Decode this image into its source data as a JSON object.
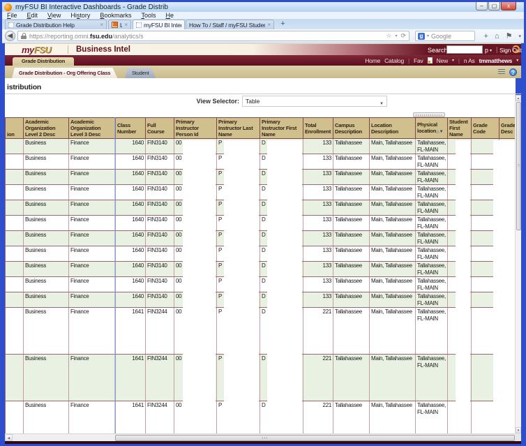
{
  "browser": {
    "title": "myFSU BI Interactive Dashboards - Grade Distrib",
    "menu": [
      {
        "pre": "",
        "key": "F",
        "rest": "ile"
      },
      {
        "pre": "",
        "key": "E",
        "rest": "dit"
      },
      {
        "pre": "",
        "key": "V",
        "rest": "iew"
      },
      {
        "pre": "Hi",
        "key": "s",
        "rest": "tory"
      },
      {
        "pre": "",
        "key": "B",
        "rest": "ookmarks"
      },
      {
        "pre": "",
        "key": "T",
        "rest": "ools"
      },
      {
        "pre": "",
        "key": "H",
        "rest": "e"
      }
    ],
    "tabs": [
      {
        "label": "Grade Distribution Help",
        "favicon": "blank",
        "active": false,
        "closable": true
      },
      {
        "label": "L",
        "favicon": "orange",
        "active": false,
        "closable": true
      },
      {
        "label": "myFSU BI Interactiv",
        "favicon": "blank",
        "active": true,
        "closable": false
      },
      {
        "label": "How To / Staff / myFSU Student Cent...",
        "favicon": "none",
        "active": false,
        "closable": true
      }
    ],
    "new_tab": "+",
    "url": {
      "pre": "https://reporting.omni.",
      "domain": "fsu.edu",
      "path": "/analytics/s"
    },
    "search_engine": "Google",
    "window_buttons": {
      "minimize": "–",
      "maximize": "▢",
      "close": "x"
    }
  },
  "portal": {
    "logo_my": "my",
    "logo_fsu": "FSU",
    "app": "Business Intel",
    "search_label": "Search",
    "help_tail": "p",
    "sign_out": "Sign Out",
    "links": {
      "home": "Home",
      "catalog": "Catalog",
      "favorites": "Fav",
      "new_label": "New",
      "signed_in_tail": "n As",
      "user": "tmmatthews"
    }
  },
  "dashboard": {
    "tab": "Grade Distribution",
    "subtabs": [
      "Grade Distribution - Org Offering Class",
      "Student"
    ],
    "title_partial": "istribution",
    "view_selector": {
      "label": "View Selector:",
      "value": "Table"
    },
    "help_icon": "?"
  },
  "table": {
    "columns": [
      "ion",
      "Academic Organization Level 2 Desc",
      "Academic Organization Level 3 Desc",
      "Class Number",
      "Full Course",
      "Primary Instructor Person Id",
      "Primary Instructor Last Name",
      "Primary Instructor First Name",
      "Total Enrollment",
      "Campus Description",
      "Location Description",
      "Physical location",
      "Student First Name",
      "Grade Code",
      "Grade Desc"
    ],
    "sort_column": "Physical location",
    "rows": [
      {
        "org_l2": "Business",
        "org_l3": "Finance",
        "class_number": "1640",
        "full_course": "FIN3140",
        "person_id": "00",
        "last_name": "P",
        "first_name": "D",
        "enrollment": "133",
        "campus": "Tallahassee",
        "location": "Main, Tallahassee",
        "physical": "Tallahassee, FL-MAIN",
        "student_first": "",
        "grade_code": "",
        "grade_desc": "",
        "tall": false
      },
      {
        "org_l2": "Business",
        "org_l3": "Finance",
        "class_number": "1640",
        "full_course": "FIN3140",
        "person_id": "00",
        "last_name": "P",
        "first_name": "D",
        "enrollment": "133",
        "campus": "Tallahassee",
        "location": "Main, Tallahassee",
        "physical": "Tallahassee, FL-MAIN",
        "student_first": "",
        "grade_code": "",
        "grade_desc": "",
        "tall": false
      },
      {
        "org_l2": "Business",
        "org_l3": "Finance",
        "class_number": "1640",
        "full_course": "FIN3140",
        "person_id": "00",
        "last_name": "P",
        "first_name": "D",
        "enrollment": "133",
        "campus": "Tallahassee",
        "location": "Main, Tallahassee",
        "physical": "Tallahassee, FL-MAIN",
        "student_first": "",
        "grade_code": "",
        "grade_desc": "",
        "tall": false
      },
      {
        "org_l2": "Business",
        "org_l3": "Finance",
        "class_number": "1640",
        "full_course": "FIN3140",
        "person_id": "00",
        "last_name": "P",
        "first_name": "D",
        "enrollment": "133",
        "campus": "Tallahassee",
        "location": "Main, Tallahassee",
        "physical": "Tallahassee, FL-MAIN",
        "student_first": "",
        "grade_code": "",
        "grade_desc": "",
        "tall": false
      },
      {
        "org_l2": "Business",
        "org_l3": "Finance",
        "class_number": "1640",
        "full_course": "FIN3140",
        "person_id": "00",
        "last_name": "P",
        "first_name": "D",
        "enrollment": "133",
        "campus": "Tallahassee",
        "location": "Main, Tallahassee",
        "physical": "Tallahassee, FL-MAIN",
        "student_first": "",
        "grade_code": "",
        "grade_desc": "",
        "tall": false
      },
      {
        "org_l2": "Business",
        "org_l3": "Finance",
        "class_number": "1640",
        "full_course": "FIN3140",
        "person_id": "00",
        "last_name": "P",
        "first_name": "D",
        "enrollment": "133",
        "campus": "Tallahassee",
        "location": "Main, Tallahassee",
        "physical": "Tallahassee, FL-MAIN",
        "student_first": "",
        "grade_code": "",
        "grade_desc": "",
        "tall": false
      },
      {
        "org_l2": "Business",
        "org_l3": "Finance",
        "class_number": "1640",
        "full_course": "FIN3140",
        "person_id": "00",
        "last_name": "P",
        "first_name": "D",
        "enrollment": "133",
        "campus": "Tallahassee",
        "location": "Main, Tallahassee",
        "physical": "Tallahassee, FL-MAIN",
        "student_first": "",
        "grade_code": "",
        "grade_desc": "",
        "tall": false
      },
      {
        "org_l2": "Business",
        "org_l3": "Finance",
        "class_number": "1640",
        "full_course": "FIN3140",
        "person_id": "00",
        "last_name": "P",
        "first_name": "D",
        "enrollment": "133",
        "campus": "Tallahassee",
        "location": "Main, Tallahassee",
        "physical": "Tallahassee, FL-MAIN",
        "student_first": "",
        "grade_code": "",
        "grade_desc": "",
        "tall": false
      },
      {
        "org_l2": "Business",
        "org_l3": "Finance",
        "class_number": "1640",
        "full_course": "FIN3140",
        "person_id": "00",
        "last_name": "P",
        "first_name": "D",
        "enrollment": "133",
        "campus": "Tallahassee",
        "location": "Main, Tallahassee",
        "physical": "Tallahassee, FL-MAIN",
        "student_first": "",
        "grade_code": "",
        "grade_desc": "",
        "tall": false
      },
      {
        "org_l2": "Business",
        "org_l3": "Finance",
        "class_number": "1640",
        "full_course": "FIN3140",
        "person_id": "00",
        "last_name": "P",
        "first_name": "D",
        "enrollment": "133",
        "campus": "Tallahassee",
        "location": "Main, Tallahassee",
        "physical": "Tallahassee, FL-MAIN",
        "student_first": "",
        "grade_code": "",
        "grade_desc": "",
        "tall": false
      },
      {
        "org_l2": "Business",
        "org_l3": "Finance",
        "class_number": "1640",
        "full_course": "FIN3140",
        "person_id": "00",
        "last_name": "P",
        "first_name": "D",
        "enrollment": "133",
        "campus": "Tallahassee",
        "location": "Main, Tallahassee",
        "physical": "Tallahassee, FL-MAIN",
        "student_first": "",
        "grade_code": "",
        "grade_desc": "",
        "tall": false
      },
      {
        "org_l2": "Business",
        "org_l3": "Finance",
        "class_number": "1641",
        "full_course": "FIN3244",
        "person_id": "00",
        "last_name": "P",
        "first_name": "D",
        "enrollment": "221",
        "campus": "Tallahassee",
        "location": "Main, Tallahassee",
        "physical": "Tallahassee, FL-MAIN",
        "student_first": "",
        "grade_code": "",
        "grade_desc": "",
        "tall": true
      },
      {
        "org_l2": "Business",
        "org_l3": "Finance",
        "class_number": "1641",
        "full_course": "FIN3244",
        "person_id": "00",
        "last_name": "P",
        "first_name": "D",
        "enrollment": "221",
        "campus": "Tallahassee",
        "location": "Main, Tallahassee",
        "physical": "Tallahassee, FL-MAIN",
        "student_first": "",
        "grade_code": "",
        "grade_desc": "",
        "tall": true
      },
      {
        "org_l2": "Business",
        "org_l3": "Finance",
        "class_number": "1641",
        "full_course": "FIN3244",
        "person_id": "00",
        "last_name": "P",
        "first_name": "D",
        "enrollment": "221",
        "campus": "Tallahassee",
        "location": "Main, Tallahassee",
        "physical": "Tallahassee, FL-MAIN",
        "student_first": "",
        "grade_code": "",
        "grade_desc": "",
        "tall": true
      }
    ]
  },
  "colors": {
    "frame_blue": "#2d4ecd",
    "garnet_dark": "#5c0f1e",
    "garnet": "#7d2737",
    "gold": "#c7a252",
    "header_tan": "#d2bf8e",
    "row_green": "#e9f1e2",
    "cell_border_v": "#c49da0",
    "cell_border_h": "#9a686d"
  }
}
